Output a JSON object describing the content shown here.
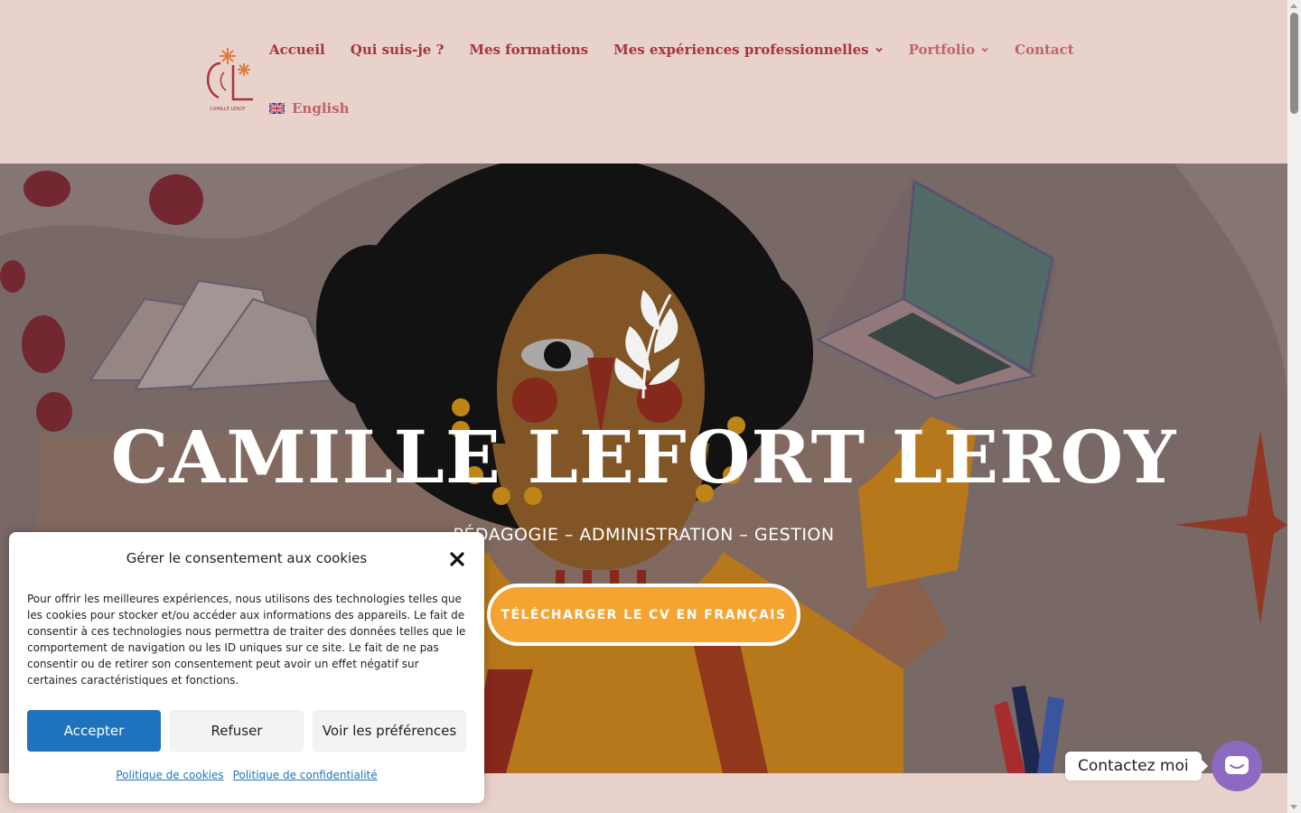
{
  "colors": {
    "header_bg": "#e8d2cb",
    "nav_text": "#a8343f",
    "nav_text_muted": "#c0636b",
    "cta_bg": "#f5a431",
    "accept_bg": "#1e73be",
    "contact_widget_bg": "#8c6ac0"
  },
  "header": {
    "logo_icon": "cl-monogram-logo",
    "logo_caption": "CAMILLE LEROY",
    "nav": [
      {
        "label": "Accueil"
      },
      {
        "label": "Qui suis-je ?"
      },
      {
        "label": "Mes formations"
      },
      {
        "label": "Mes expériences professionnelles",
        "has_dropdown": true
      },
      {
        "label": "Portfolio",
        "has_dropdown": true
      },
      {
        "label": "Contact"
      }
    ],
    "language": {
      "label": "English",
      "icon": "uk-flag-icon"
    }
  },
  "hero": {
    "title": "CAMILLE LEFORT LEROY",
    "subtitle": "PÉDAGOGIE – ADMINISTRATION – GESTION",
    "cta_label": "TÉLÉCHARGER LE CV EN FRANÇAIS",
    "leaf_icon": "leaf-branch-icon"
  },
  "cookie_banner": {
    "title": "Gérer le consentement aux cookies",
    "text": "Pour offrir les meilleures expériences, nous utilisons des technologies telles que les cookies pour stocker et/ou accéder aux informations des appareils. Le fait de consentir à ces technologies nous permettra de traiter des données telles que le comportement de navigation ou les ID uniques sur ce site. Le fait de ne pas consentir ou de retirer son consentement peut avoir un effet négatif sur certaines caractéristiques et fonctions.",
    "accept_label": "Accepter",
    "refuse_label": "Refuser",
    "prefs_label": "Voir les préférences",
    "cookie_policy_link": "Politique de cookies",
    "privacy_policy_link": "Politique de confidentialité"
  },
  "contact_widget": {
    "label": "Contactez moi",
    "icon": "chat-bubble-icon"
  }
}
